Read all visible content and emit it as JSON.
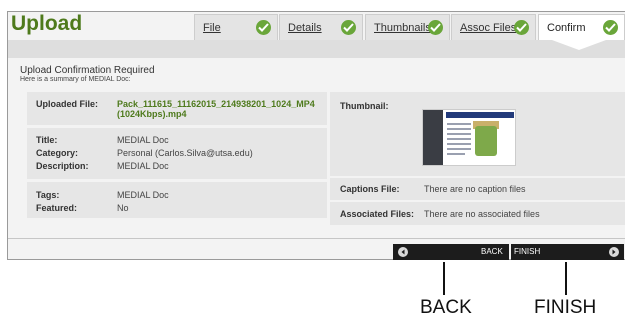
{
  "page": {
    "title": "Upload",
    "tabs": [
      {
        "label": "File"
      },
      {
        "label": "Details"
      },
      {
        "label": "Thumbnails"
      },
      {
        "label": "Assoc Files"
      },
      {
        "label": "Confirm"
      }
    ]
  },
  "confirmation": {
    "heading": "Upload Confirmation Required",
    "subheading": "Here is a summary of MEDIAL Doc:",
    "uploaded_file_label": "Uploaded File:",
    "uploaded_file_line1": "Pack_111615_11162015_214938201_1024_MP4",
    "uploaded_file_line2": "(1024Kbps).mp4",
    "title_label": "Title:",
    "title_value": "MEDIAL Doc",
    "category_label": "Category:",
    "category_value": "Personal (Carlos.Silva@utsa.edu)",
    "description_label": "Description:",
    "description_value": "MEDIAL Doc",
    "tags_label": "Tags:",
    "tags_value": "MEDIAL Doc",
    "featured_label": "Featured:",
    "featured_value": "No",
    "thumbnail_label": "Thumbnail:",
    "captions_label": "Captions File:",
    "captions_value": "There are no caption files",
    "associated_label": "Associated Files:",
    "associated_value": "There are no associated files"
  },
  "buttons": {
    "back": "BACK",
    "finish": "FINISH"
  },
  "callouts": {
    "back": "BACK",
    "finish": "FINISH"
  },
  "colors": {
    "accent": "#4e7a1c",
    "check": "#6aa63a",
    "button": "#1c1c1c"
  }
}
